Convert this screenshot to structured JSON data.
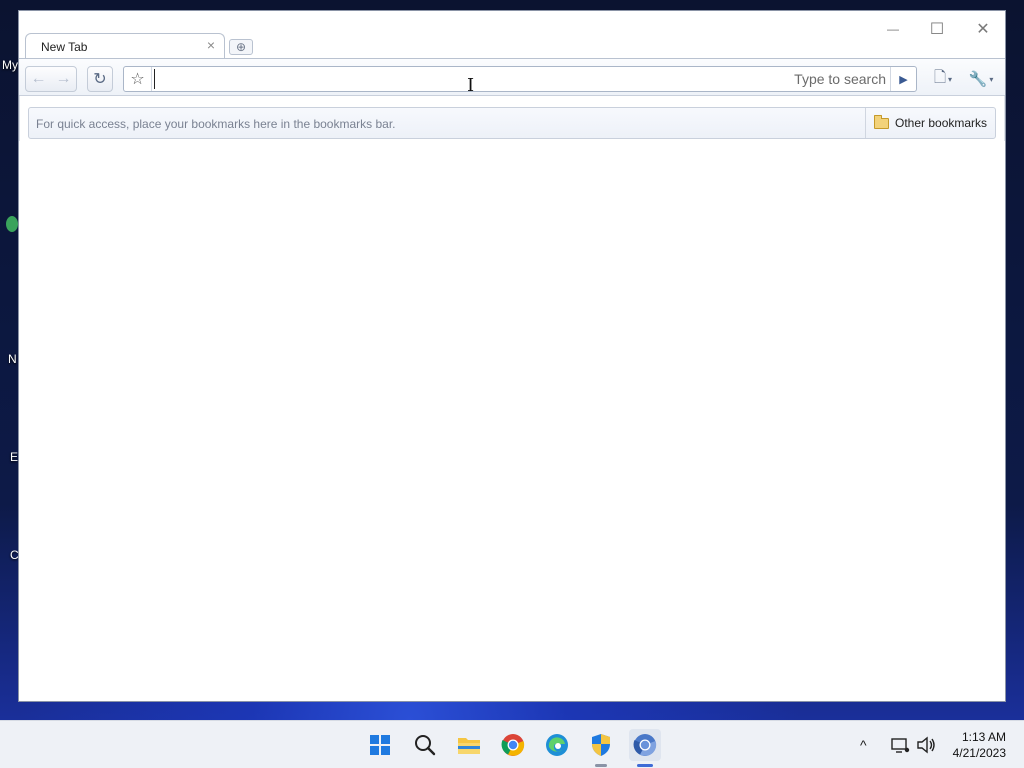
{
  "desktop": {
    "icon_labels": [
      "My",
      "N",
      "E",
      "C"
    ]
  },
  "window": {
    "controls": {
      "minimize": "—",
      "maximize": "☐",
      "close": "✕"
    },
    "tab": {
      "title": "New Tab",
      "close": "×"
    },
    "new_tab_symbol": "⊕",
    "toolbar": {
      "back_icon": "←",
      "forward_icon": "→",
      "reload_icon": "↻",
      "star_icon": "☆",
      "omnibox_value": "",
      "omnibox_hint": "Type to search",
      "go_icon": "▶",
      "page_menu_icon": "🗋",
      "wrench_menu_icon": "🔧",
      "caret": "▾"
    },
    "bookmarks_bar": {
      "hint": "For quick access, place your bookmarks here in the bookmarks bar.",
      "other_bookmarks": "Other bookmarks"
    },
    "cursor_glyph": "I"
  },
  "taskbar": {
    "apps": [
      {
        "name": "start-icon"
      },
      {
        "name": "search-icon"
      },
      {
        "name": "file-explorer-icon"
      },
      {
        "name": "chrome-icon"
      },
      {
        "name": "edge-icon"
      },
      {
        "name": "security-shield-icon"
      },
      {
        "name": "chromium-icon"
      }
    ],
    "tray": {
      "chevron": "^",
      "time": "1:13 AM",
      "date": "4/21/2023"
    }
  },
  "colors": {
    "accent": "#3e6bd6",
    "tab_border": "#b9c2d0",
    "toolbar_bg": "#eef2f8"
  }
}
